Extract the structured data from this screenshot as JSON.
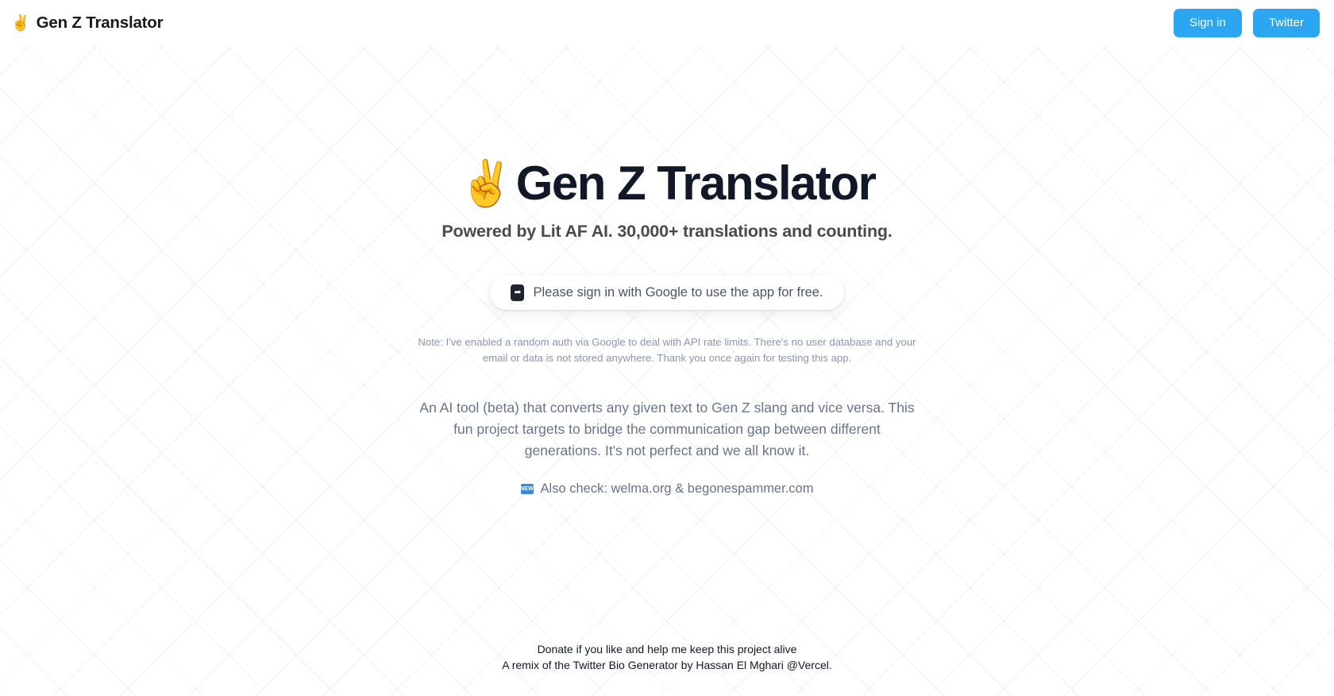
{
  "header": {
    "brand_emoji": "✌️",
    "brand_emoji_name": "victory-hand-emoji",
    "brand_title": "Gen Z Translator",
    "signin_label": "Sign in",
    "twitter_label": "Twitter",
    "accent_color": "#2da6f2"
  },
  "hero": {
    "emoji": "✌️",
    "title": "Gen Z Translator",
    "subtitle": "Powered by Lit AF AI. 30,000+ translations and counting.",
    "title_color": "#111827"
  },
  "signin_prompt": {
    "icon_glyph": "➦",
    "text": "Please sign in with Google to use the app for free."
  },
  "note": {
    "text": "Note: I've enabled a random auth via Google to deal with API rate limits. There's no user database and your email or data is not stored anywhere. Thank you once again for testing this app."
  },
  "description": {
    "text": "An AI tool (beta) that converts any given text to Gen Z slang and vice versa. This fun project targets to bridge the communication gap between different generations. It's not perfect and we all know it."
  },
  "also_check": {
    "badge_label": "NEW",
    "badge_color": "#2f8fe0",
    "text": "Also check: welma.org & begonespammer.com"
  },
  "footer": {
    "line1": "Donate if you like and help me keep this project alive",
    "line2": "A remix of the Twitter Bio Generator by Hassan El Mghari @Vercel."
  }
}
